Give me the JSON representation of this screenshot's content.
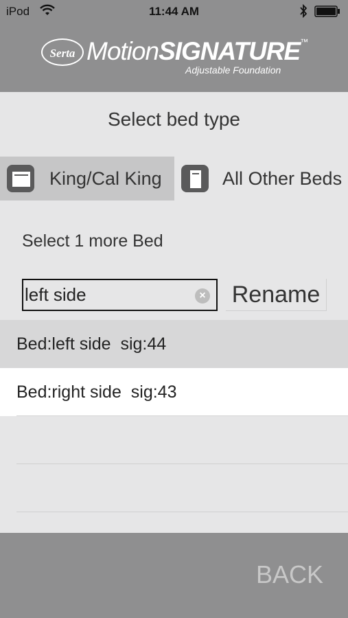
{
  "status_bar": {
    "carrier": "iPod",
    "time": "11:44 AM"
  },
  "brand": {
    "logo_text": "Serta",
    "motion_text": "Motion",
    "signature_text": "SIGNATURE",
    "trademark": "™",
    "tagline": "Adjustable Foundation"
  },
  "title": "Select bed type",
  "bed_types": [
    {
      "label": "King/Cal King",
      "selected": true,
      "icon": "king-bed-icon"
    },
    {
      "label": "All Other Beds",
      "selected": false,
      "icon": "single-bed-icon"
    }
  ],
  "instruction": "Select 1 more Bed",
  "name_field": {
    "value": "left side",
    "placeholder": ""
  },
  "rename_label": "Rename",
  "beds": [
    {
      "label": "Bed:left side  sig:44",
      "selected": true
    },
    {
      "label": "Bed:right side  sig:43",
      "selected": false
    }
  ],
  "back_label": "BACK",
  "colors": {
    "header_bg": "#8f8f90",
    "body_bg": "#e6e6e7",
    "selected_bg": "#c6c6c7"
  }
}
